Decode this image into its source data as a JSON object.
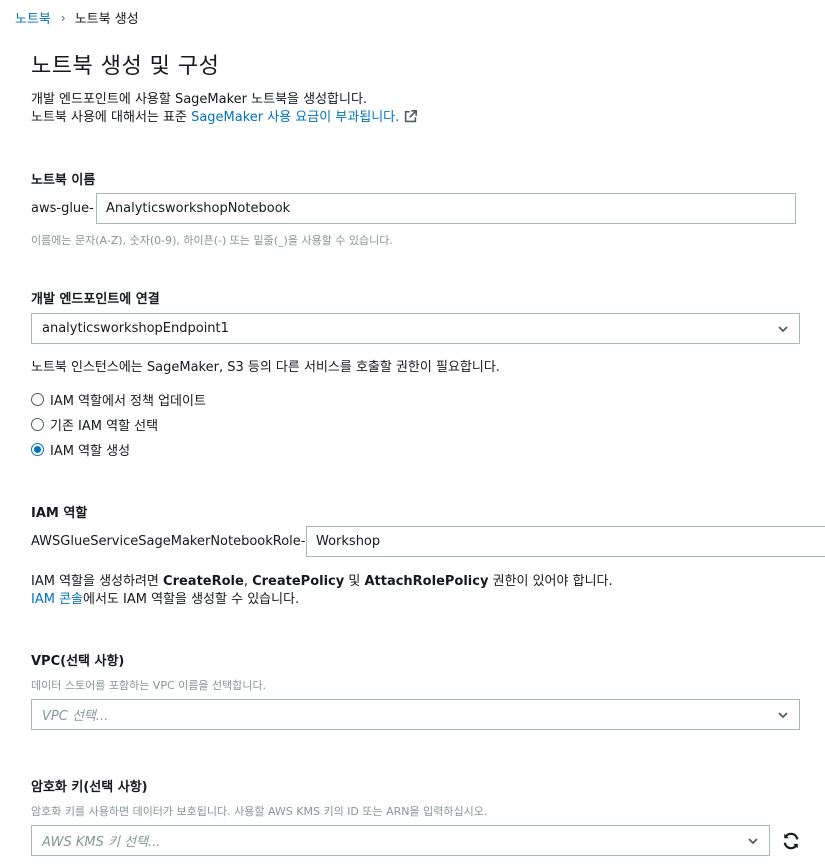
{
  "breadcrumb": {
    "parent": "노트북",
    "separator": "›",
    "current": "노트북 생성"
  },
  "page_title": "노트북 생성 및 구성",
  "description": {
    "line1": "개발 엔드포인트에 사용할 SageMaker 노트북을 생성합니다.",
    "line2_text": "노트북 사용에 대해서는 표준 ",
    "line2_link": "SageMaker 사용 요금이 부과됩니다.",
    "external_icon": "external-link-icon"
  },
  "notebook_name": {
    "label": "노트북 이름",
    "prefix": "aws-glue-",
    "value": "AnalyticsworkshopNotebook",
    "hint": "이름에는 문자(A-Z), 숫자(0-9), 하이픈(-) 또는 밑줄(_)을 사용할 수 있습니다."
  },
  "endpoint": {
    "label": "개발 엔드포인트에 연결",
    "selected": "analyticsworkshopEndpoint1",
    "note": "노트북 인스턴스에는 SageMaker, S3 등의 다른 서비스를 호출할 권한이 필요합니다."
  },
  "iam_options": [
    {
      "label": "IAM 역할에서 정책 업데이트",
      "checked": false
    },
    {
      "label": "기존 IAM 역할 선택",
      "checked": false
    },
    {
      "label": "IAM 역할 생성",
      "checked": true
    }
  ],
  "iam_role": {
    "label": "IAM 역할",
    "prefix": "AWSGlueServiceSageMakerNotebookRole-",
    "value": "Workshop",
    "note_pre": "IAM 역할을 생성하려면 ",
    "perm1": "CreateRole",
    "sep1": ", ",
    "perm2": "CreatePolicy",
    "sep2": " 및 ",
    "perm3": "AttachRolePolicy",
    "note_post": " 권한이 있어야 합니다.",
    "console_link": "IAM 콘솔",
    "console_post": "에서도 IAM 역할을 생성할 수 있습니다."
  },
  "vpc": {
    "label": "VPC(선택 사항)",
    "hint": "데이터 스토어를 포함하는 VPC 이름을 선택합니다.",
    "placeholder": "VPC 선택..."
  },
  "encryption": {
    "label": "암호화 키(선택 사항)",
    "hint": "암호화 키를 사용하면 데이터가 보호됩니다. 사용할 AWS KMS 키의 ID 또는 ARN을 입력하십시오.",
    "placeholder": "AWS KMS 키 선택...",
    "refresh_icon": "refresh-icon"
  },
  "colors": {
    "link": "#0073bb",
    "border": "#aab7b8",
    "hint": "#879596",
    "text": "#16191f"
  }
}
